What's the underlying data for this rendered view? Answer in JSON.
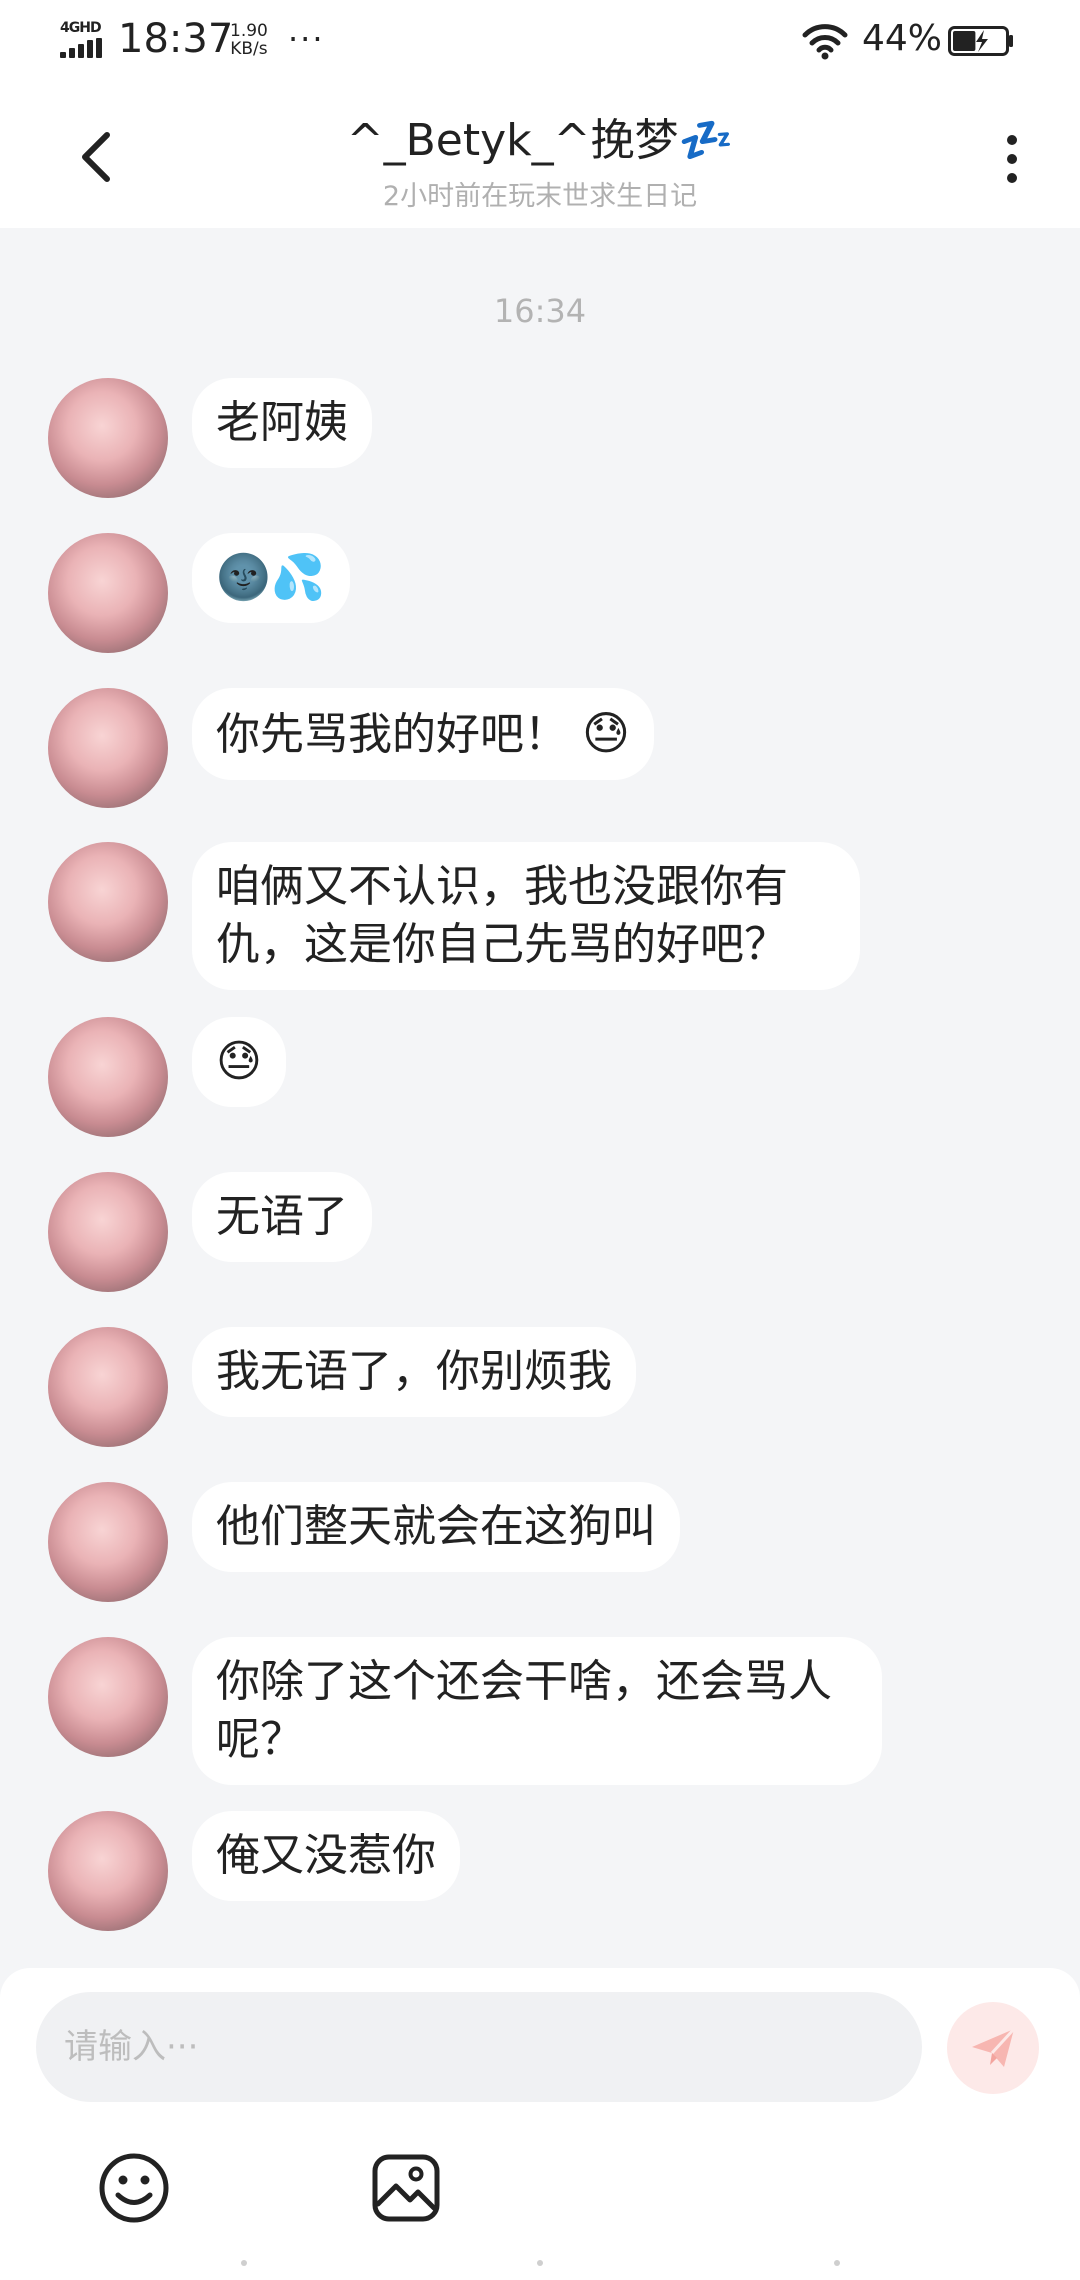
{
  "status_bar": {
    "network": "4GHD",
    "time": "18:37",
    "speed_value": "1.90",
    "speed_unit": "KB/s",
    "more": "···",
    "battery_percent": "44%",
    "battery_level": 0.44
  },
  "header": {
    "title": "^_Betyk_^挽梦💤",
    "subtitle": "2小时前在玩末世求生日记"
  },
  "chat": {
    "timestamp": "16:34",
    "messages": [
      {
        "text": "老阿姨"
      },
      {
        "text": "🌚💦"
      },
      {
        "text": "你先骂我的好吧！",
        "emoji": "😓"
      },
      {
        "text": "咱俩又不认识，我也没跟你有仇，这是你自己先骂的好吧？"
      },
      {
        "text": "😓"
      },
      {
        "text": "无语了"
      },
      {
        "text": "我无语了，你别烦我"
      },
      {
        "text": "他们整天就会在这狗叫"
      },
      {
        "text": "你除了这个还会干啥，还会骂人呢？"
      },
      {
        "text": "俺又没惹你"
      }
    ]
  },
  "input": {
    "placeholder": "请输入···"
  },
  "colors": {
    "background": "#f4f5f7",
    "bubble": "#ffffff",
    "send_button": "#fde9e8",
    "send_icon": "#f7b6b1",
    "subtitle": "#b0b0b0"
  },
  "icons": {
    "back": "chevron-left-icon",
    "more": "more-vertical-icon",
    "send": "send-icon",
    "emoji": "emoji-icon",
    "image": "image-icon",
    "wifi": "wifi-icon",
    "battery": "battery-icon"
  }
}
